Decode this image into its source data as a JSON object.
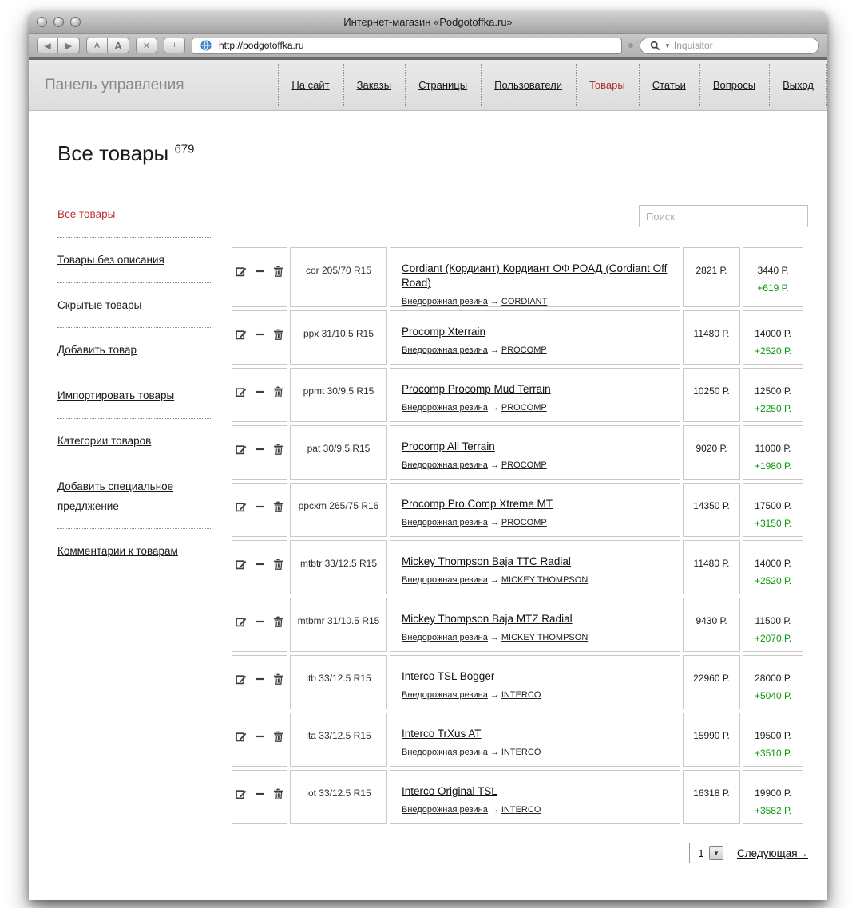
{
  "browser": {
    "window_title": "Интернет-магазин «Podgotoffka.ru»",
    "url": "http://podgotoffka.ru",
    "search_placeholder": "Inquisitor",
    "toolbar": {
      "back": "◀",
      "forward": "▶",
      "font_smaller": "A",
      "font_bigger": "A",
      "stop": "✕",
      "add": "+"
    }
  },
  "nav": {
    "brand": "Панель управления",
    "items": [
      {
        "label": "На сайт",
        "active": false
      },
      {
        "label": "Заказы",
        "active": false
      },
      {
        "label": "Страницы",
        "active": false
      },
      {
        "label": "Пользователи",
        "active": false
      },
      {
        "label": "Товары",
        "active": true
      },
      {
        "label": "Статьи",
        "active": false
      },
      {
        "label": "Вопросы",
        "active": false
      },
      {
        "label": "Выход",
        "active": false
      }
    ]
  },
  "page": {
    "title": "Все товары",
    "count": "679",
    "search_placeholder": "Поиск"
  },
  "sidebar": {
    "items": [
      {
        "label": "Все товары",
        "active": true
      },
      {
        "label": "Товары без описания",
        "active": false
      },
      {
        "label": "Скрытые товары",
        "active": false
      },
      {
        "label": "Добавить товар",
        "active": false
      },
      {
        "label": "Импортировать товары",
        "active": false
      },
      {
        "label": "Категории товаров",
        "active": false
      },
      {
        "label": "Добавить специальное предлжение",
        "active": false
      },
      {
        "label": "Комментарии к товарам",
        "active": false
      }
    ]
  },
  "table": {
    "arrow": "→",
    "category": "Внедорожная резина",
    "rows": [
      {
        "code": "cor 205/70 R15",
        "name": "Cordiant (Кордиант) Кордиант ОФ РОАД (Cordiant Off Road)",
        "category": "Внедорожная резина",
        "brand": "CORDIANT",
        "price_purchase": "2821 Р.",
        "price_sale": "3440 Р.",
        "price_diff": "+619 Р."
      },
      {
        "code": "ppx 31/10.5 R15",
        "name": "Procomp Xterrain",
        "category": "Внедорожная резина",
        "brand": "PROCOMP",
        "price_purchase": "11480 Р.",
        "price_sale": "14000 Р.",
        "price_diff": "+2520 Р."
      },
      {
        "code": "ppmt 30/9.5 R15",
        "name": "Procomp Procomp Mud Terrain",
        "category": "Внедорожная резина",
        "brand": "PROCOMP",
        "price_purchase": "10250 Р.",
        "price_sale": "12500 Р.",
        "price_diff": "+2250 Р."
      },
      {
        "code": "pat 30/9.5 R15",
        "name": "Procomp All Terrain",
        "category": "Внедорожная резина",
        "brand": "PROCOMP",
        "price_purchase": "9020 Р.",
        "price_sale": "11000 Р.",
        "price_diff": "+1980 Р."
      },
      {
        "code": "ppcxm 265/75 R16",
        "name": "Procomp Pro Comp Xtreme MT",
        "category": "Внедорожная резина",
        "brand": "PROCOMP",
        "price_purchase": "14350 Р.",
        "price_sale": "17500 Р.",
        "price_diff": "+3150 Р."
      },
      {
        "code": "mtbtr 33/12.5 R15",
        "name": "Mickey Thompson Baja TTC Radial",
        "category": "Внедорожная резина",
        "brand": "MICKEY THOMPSON",
        "price_purchase": "11480 Р.",
        "price_sale": "14000 Р.",
        "price_diff": "+2520 Р."
      },
      {
        "code": "mtbmr 31/10.5 R15",
        "name": "Mickey Thompson Baja MTZ Radial",
        "category": "Внедорожная резина",
        "brand": "MICKEY THOMPSON",
        "price_purchase": "9430 Р.",
        "price_sale": "11500 Р.",
        "price_diff": "+2070 Р."
      },
      {
        "code": "itb 33/12.5 R15",
        "name": "Interco TSL Bogger",
        "category": "Внедорожная резина",
        "brand": "INTERCO",
        "price_purchase": "22960 Р.",
        "price_sale": "28000 Р.",
        "price_diff": "+5040 Р."
      },
      {
        "code": "ita 33/12.5 R15",
        "name": "Interco TrXus AT",
        "category": "Внедорожная резина",
        "brand": "INTERCO",
        "price_purchase": "15990 Р.",
        "price_sale": "19500 Р.",
        "price_diff": "+3510 Р."
      },
      {
        "code": "iot 33/12.5 R15",
        "name": "Interco Original TSL",
        "category": "Внедорожная резина",
        "brand": "INTERCO",
        "price_purchase": "16318 Р.",
        "price_sale": "19900 Р.",
        "price_diff": "+3582 Р."
      }
    ]
  },
  "pagination": {
    "current_page": "1",
    "next_label": "Следующая→"
  },
  "colors": {
    "accent_red": "#b03030",
    "markup_green": "#0b9b0b",
    "sale_cell_bg": "#d3e0fa"
  }
}
